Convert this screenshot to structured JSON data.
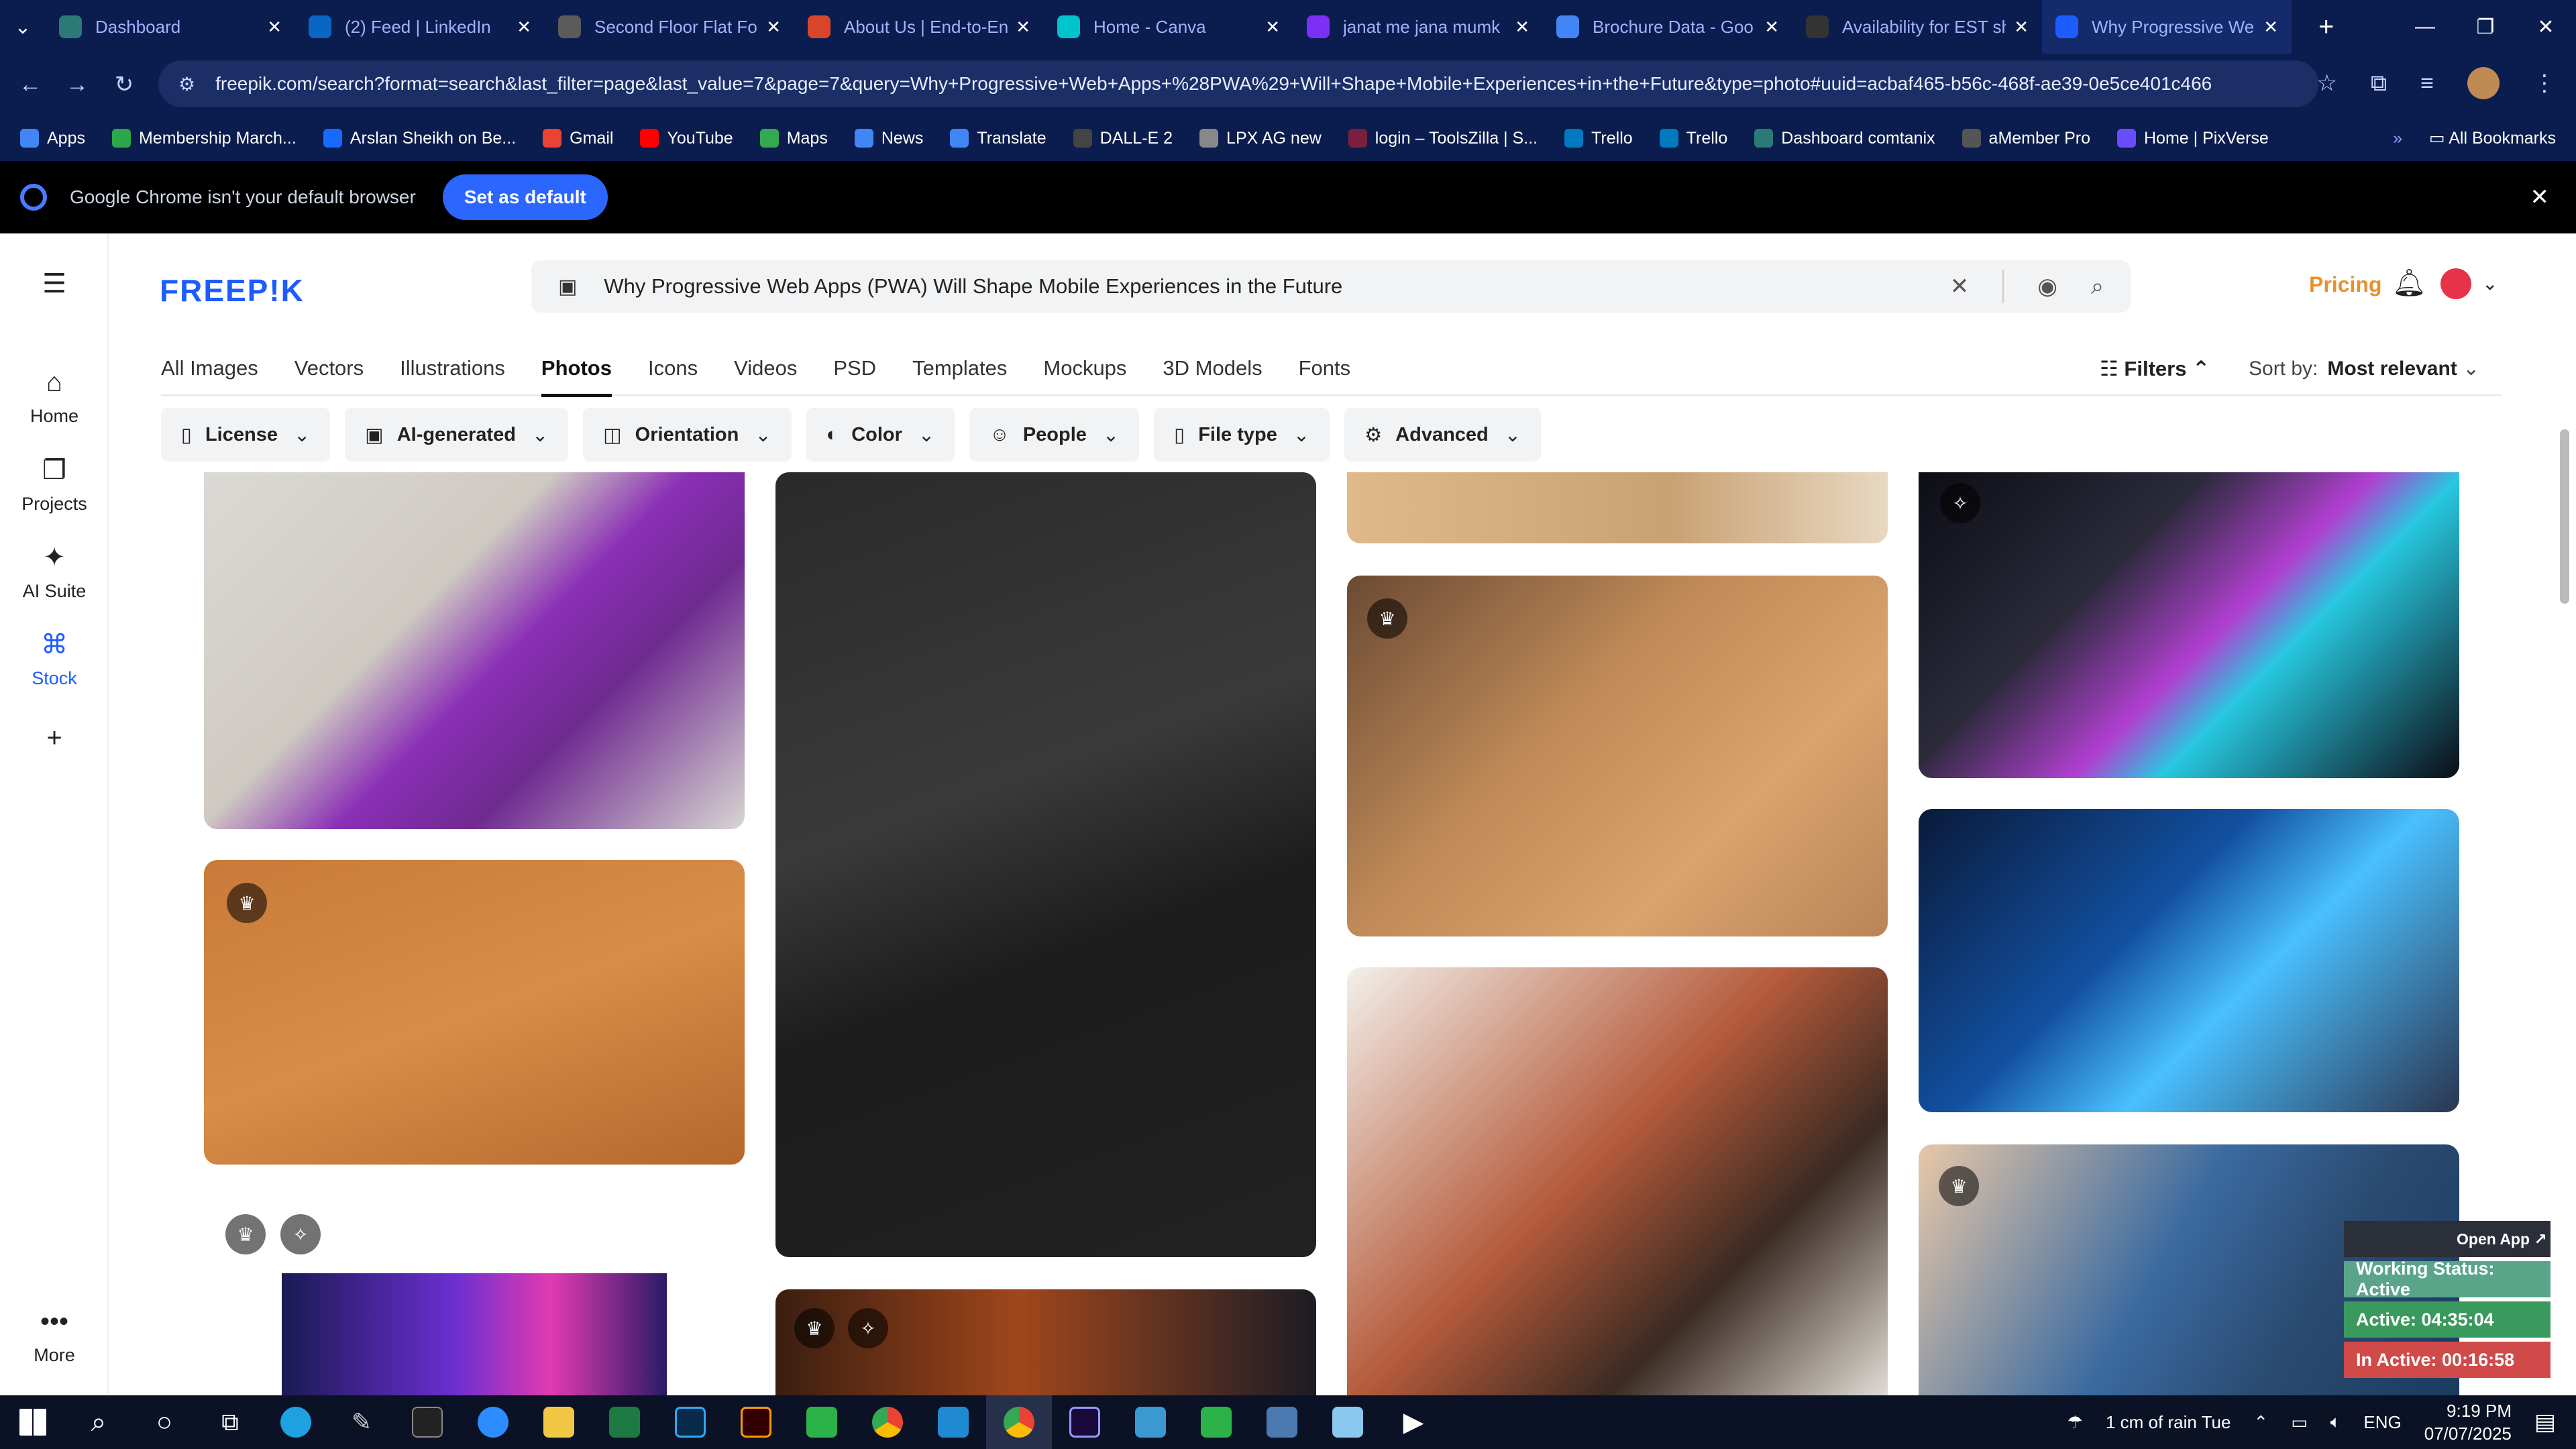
{
  "browser": {
    "tabs": [
      {
        "label": "Dashboard",
        "color": "#2b7a78"
      },
      {
        "label": "(2) Feed | LinkedIn",
        "color": "#0a66c2"
      },
      {
        "label": "Second Floor Flat For",
        "color": "#5b5b5b"
      },
      {
        "label": "About Us | End-to-En",
        "color": "#d9452b"
      },
      {
        "label": "Home - Canva",
        "color": "#00c4cc"
      },
      {
        "label": "janat me jana mumk",
        "color": "#7b2ff7"
      },
      {
        "label": "Brochure Data - Goo",
        "color": "#4285f4"
      },
      {
        "label": "Availability for EST sh",
        "color": "#333333"
      },
      {
        "label": "Why Progressive We",
        "color": "#1d5cff"
      }
    ],
    "url": "freepik.com/search?format=search&last_filter=page&last_value=7&page=7&query=Why+Progressive+Web+Apps+%28PWA%29+Will+Shape+Mobile+Experiences+in+the+Future&type=photo#uuid=acbaf465-b56c-468f-ae39-0e5ce401c466",
    "bookmarks": [
      {
        "label": "Apps",
        "color": "#4285f4"
      },
      {
        "label": "Membership March...",
        "color": "#2aa84a"
      },
      {
        "label": "Arslan Sheikh on Be...",
        "color": "#1769ff"
      },
      {
        "label": "Gmail",
        "color": "#ea4335"
      },
      {
        "label": "YouTube",
        "color": "#ff0000"
      },
      {
        "label": "Maps",
        "color": "#34a853"
      },
      {
        "label": "News",
        "color": "#4285f4"
      },
      {
        "label": "Translate",
        "color": "#4285f4"
      },
      {
        "label": "DALL-E 2",
        "color": "#444444"
      },
      {
        "label": "LPX AG new",
        "color": "#888888"
      },
      {
        "label": "login – ToolsZilla | S...",
        "color": "#7a1f3d"
      },
      {
        "label": "Trello",
        "color": "#0079bf"
      },
      {
        "label": "Trello",
        "color": "#0079bf"
      },
      {
        "label": "Dashboard comtanix",
        "color": "#2b7a78"
      },
      {
        "label": "aMember Pro",
        "color": "#555555"
      },
      {
        "label": "Home | PixVerse",
        "color": "#6a4cff"
      }
    ],
    "all_bookmarks": "All Bookmarks",
    "infobar_text": "Google Chrome isn't your default browser",
    "infobar_button": "Set as default"
  },
  "sidebar": {
    "items": [
      {
        "label": "Home",
        "icon": "⌂"
      },
      {
        "label": "Projects",
        "icon": "❐"
      },
      {
        "label": "AI Suite",
        "icon": "✦"
      },
      {
        "label": "Stock",
        "icon": "⌘"
      },
      {
        "label": "",
        "icon": "+"
      },
      {
        "label": "More",
        "icon": "•••"
      }
    ]
  },
  "header": {
    "logo": "FREEP!K",
    "search_value": "Why Progressive Web Apps (PWA) Will Shape Mobile Experiences in the Future",
    "pricing": "Pricing"
  },
  "nav_tabs": [
    "All Images",
    "Vectors",
    "Illustrations",
    "Photos",
    "Icons",
    "Videos",
    "PSD",
    "Templates",
    "Mockups",
    "3D Models",
    "Fonts"
  ],
  "filters_label": "Filters",
  "sort": {
    "label": "Sort by:",
    "value": "Most relevant"
  },
  "chips": [
    {
      "label": "License",
      "icon": "▯"
    },
    {
      "label": "AI-generated",
      "icon": "▣"
    },
    {
      "label": "Orientation",
      "icon": "◫"
    },
    {
      "label": "Color",
      "icon": "◐"
    },
    {
      "label": "People",
      "icon": "☺"
    },
    {
      "label": "File type",
      "icon": "▯"
    },
    {
      "label": "Advanced",
      "icon": "⚙"
    }
  ],
  "status_widget": {
    "open_app": "Open App ↗",
    "working": "Working Status: Active",
    "active": "Active: 04:35:04",
    "inactive": "In Active: 00:16:58"
  },
  "taskbar": {
    "weather": "1 cm of rain Tue",
    "lang": "ENG",
    "time": "9:19 PM",
    "date": "07/07/2025"
  }
}
